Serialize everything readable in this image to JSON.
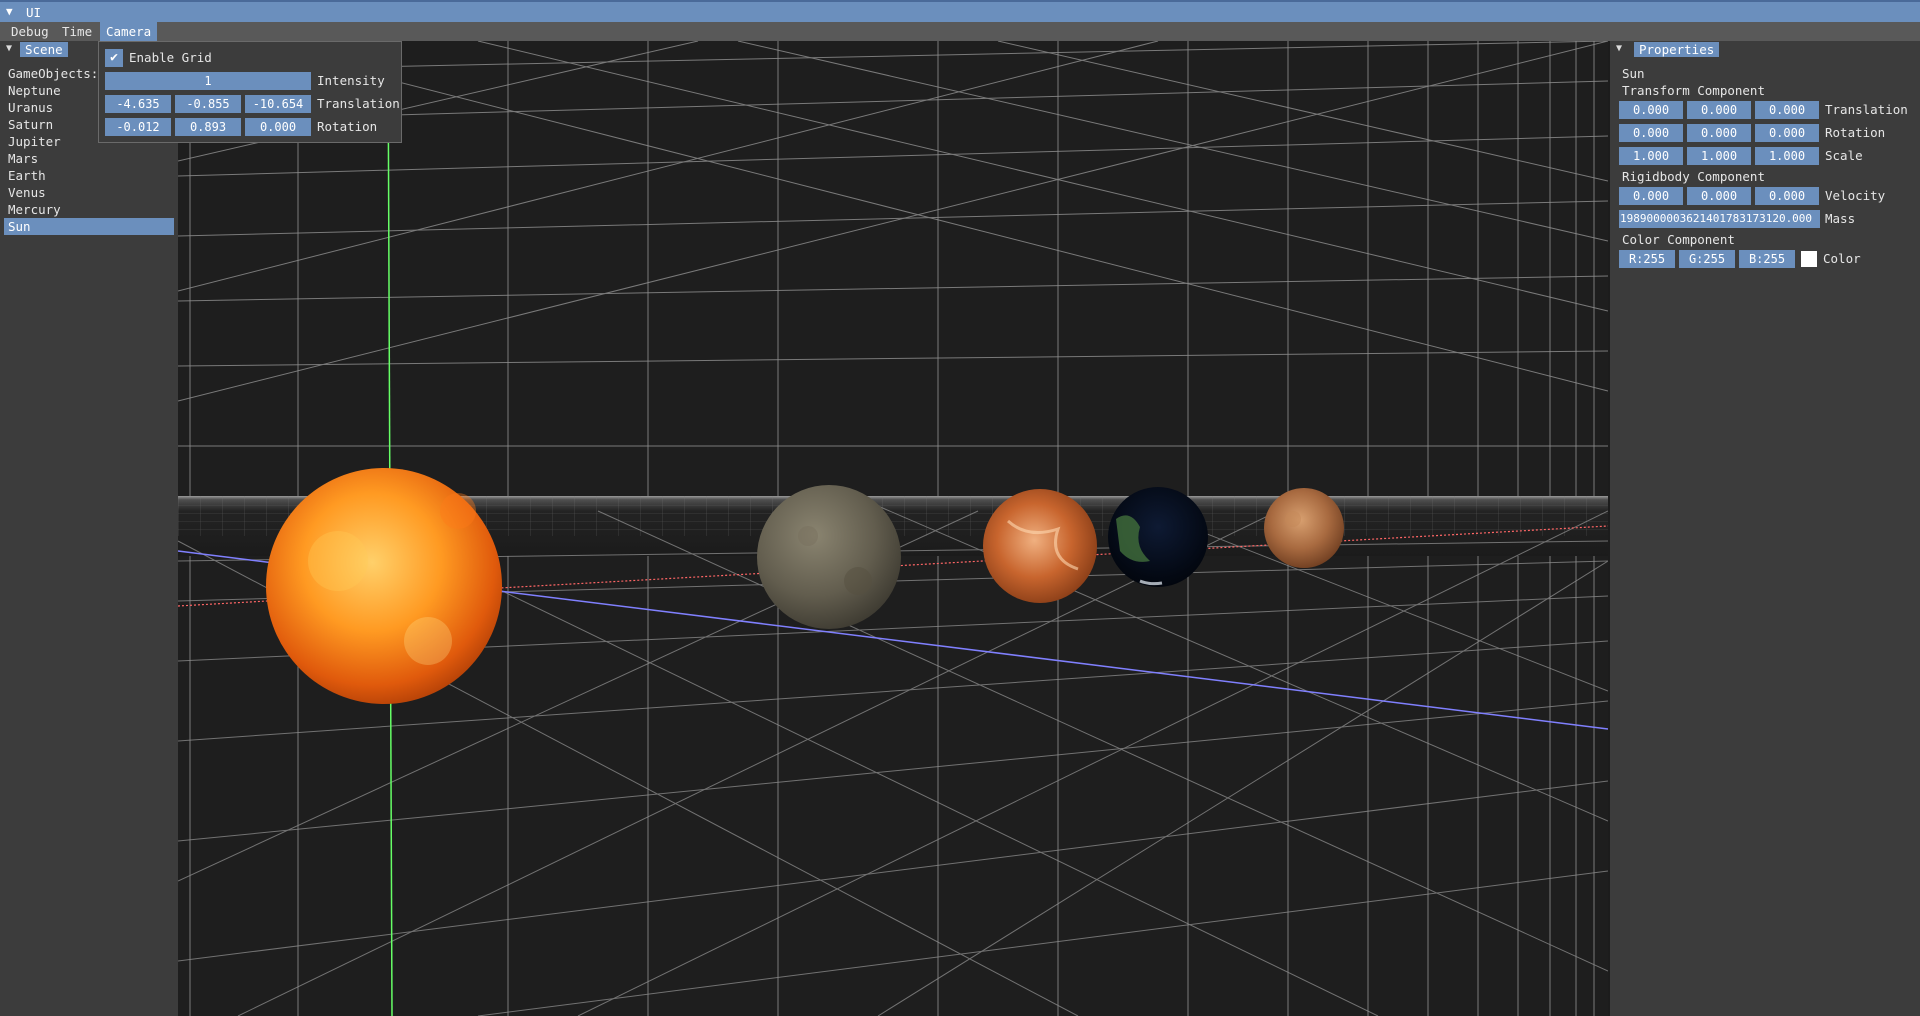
{
  "window": {
    "title": "UI"
  },
  "menubar": {
    "items": [
      "Debug",
      "Time",
      "Camera"
    ],
    "active": "Camera"
  },
  "scene": {
    "tab": "Scene",
    "heading": "GameObjects:",
    "objects": [
      "Neptune",
      "Uranus",
      "Saturn",
      "Jupiter",
      "Mars",
      "Earth",
      "Venus",
      "Mercury",
      "Sun"
    ],
    "selected": "Sun"
  },
  "camera": {
    "enable_grid_label": "Enable Grid",
    "enable_grid": true,
    "intensity_value": "1",
    "intensity_label": "Intensity",
    "translation": [
      "-4.635",
      "-0.855",
      "-10.654"
    ],
    "translation_label": "Translation",
    "rotation": [
      "-0.012",
      "0.893",
      "0.000"
    ],
    "rotation_label": "Rotation"
  },
  "properties": {
    "tab": "Properties",
    "object_name": "Sun",
    "transform_heading": "Transform Component",
    "translation": [
      "0.000",
      "0.000",
      "0.000"
    ],
    "translation_label": "Translation",
    "rotation": [
      "0.000",
      "0.000",
      "0.000"
    ],
    "rotation_label": "Rotation",
    "scale": [
      "1.000",
      "1.000",
      "1.000"
    ],
    "scale_label": "Scale",
    "rigidbody_heading": "Rigidbody Component",
    "velocity": [
      "0.000",
      "0.000",
      "0.000"
    ],
    "velocity_label": "Velocity",
    "mass_value": "1989000003621401783173120.000",
    "mass_label": "Mass",
    "color_heading": "Color Component",
    "color_r": "R:255",
    "color_g": "G:255",
    "color_b": "B:255",
    "color_label": "Color",
    "color_swatch": "#ffffff"
  },
  "colors": {
    "accent": "#6b8fbd",
    "panel_bg": "#3c3c3c",
    "viewport_bg": "#1d1d1d",
    "grid_line": "#8a8a8a",
    "axis_x": "#ff6666",
    "axis_y": "#66ff66",
    "axis_z": "#8080ff"
  }
}
